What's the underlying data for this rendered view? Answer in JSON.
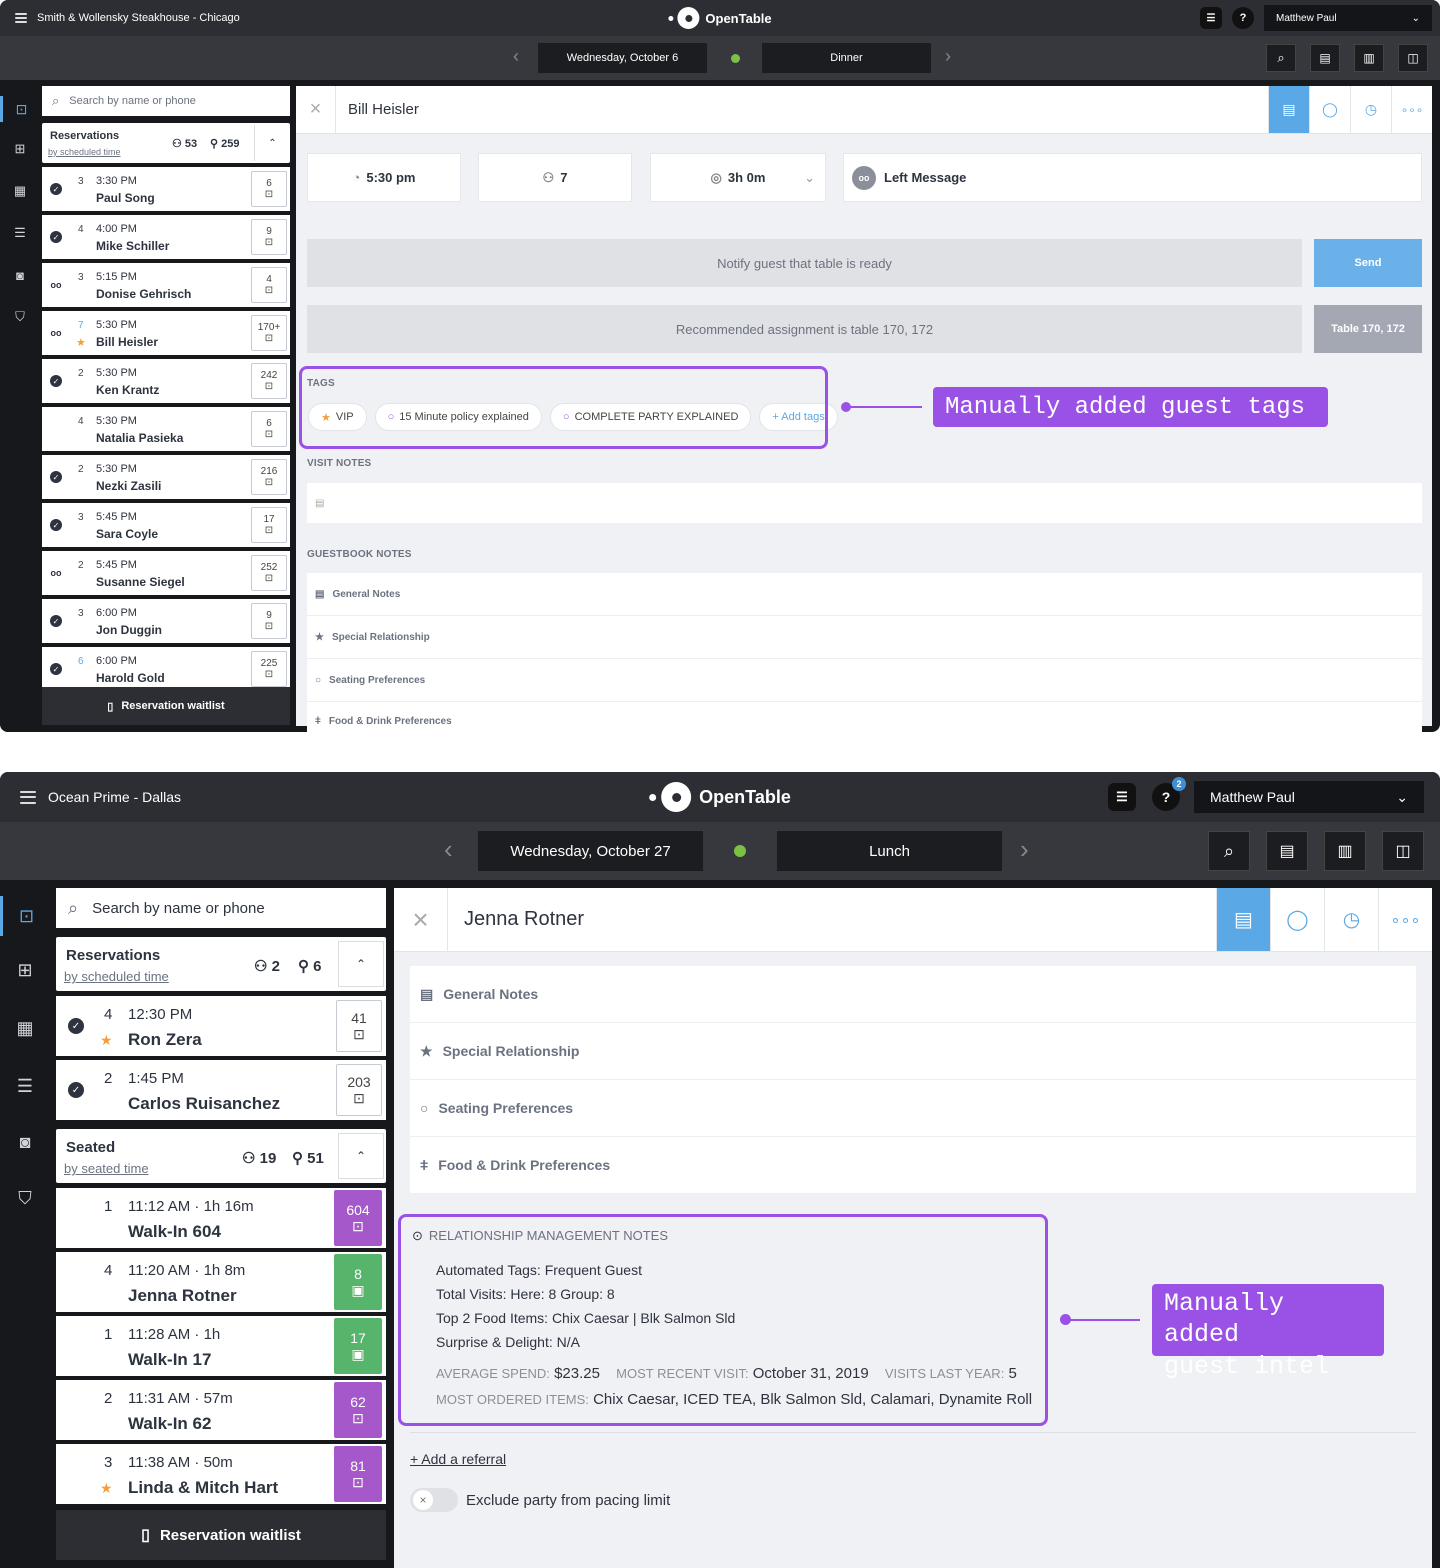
{
  "screen1": {
    "venue": "Smith & Wollensky Steakhouse - Chicago",
    "brand": "OpenTable",
    "user": "Matthew Paul",
    "date": "Wednesday, October 6",
    "shift": "Dinner",
    "search_placeholder": "Search by name or phone",
    "res_title": "Reservations",
    "res_sub": "by scheduled time",
    "res_parties": "53",
    "res_covers": "259",
    "reservations": [
      {
        "size": "3",
        "time": "3:30 PM",
        "name": "Paul Song",
        "table": "6",
        "status": "check"
      },
      {
        "size": "4",
        "time": "4:00 PM",
        "name": "Mike Schiller",
        "table": "9",
        "status": "check"
      },
      {
        "size": "3",
        "time": "5:15 PM",
        "name": "Donise Gehrisch",
        "table": "4",
        "status": "vm"
      },
      {
        "size": "7",
        "time": "5:30 PM",
        "name": "Bill Heisler",
        "table": "170+",
        "status": "vm"
      },
      {
        "size": "2",
        "time": "5:30 PM",
        "name": "Ken Krantz",
        "table": "242",
        "status": "check"
      },
      {
        "size": "4",
        "time": "5:30 PM",
        "name": "Natalia Pasieka",
        "table": "6",
        "status": "none"
      },
      {
        "size": "2",
        "time": "5:30 PM",
        "name": "Nezki Zasili",
        "table": "216",
        "status": "check"
      },
      {
        "size": "3",
        "time": "5:45 PM",
        "name": "Sara Coyle",
        "table": "17",
        "status": "check"
      },
      {
        "size": "2",
        "time": "5:45 PM",
        "name": "Susanne Siegel",
        "table": "252",
        "status": "vm"
      },
      {
        "size": "3",
        "time": "6:00 PM",
        "name": "Jon Duggin",
        "table": "9",
        "status": "check"
      },
      {
        "size": "6",
        "time": "6:00 PM",
        "name": "Harold Gold",
        "table": "225",
        "status": "check"
      }
    ],
    "waitlist": "Reservation waitlist",
    "guest": "Bill Heisler",
    "time": "5:30 pm",
    "party": "7",
    "duration": "3h 0m",
    "status": "Left Message",
    "notify": "Notify guest that table is ready",
    "send": "Send",
    "recommend": "Recommended assignment is table 170, 172",
    "table_btn": "Table 170, 172",
    "tags_label": "TAGS",
    "tags": [
      "VIP",
      "15 Minute policy explained",
      "COMPLETE PARTY EXPLAINED"
    ],
    "add_tags": "+ Add tags",
    "visit_notes": "VISIT NOTES",
    "guestbook_notes": "GUESTBOOK NOTES",
    "notes": [
      "General Notes",
      "Special Relationship",
      "Seating Preferences",
      "Food & Drink Preferences"
    ],
    "callout": "Manually added guest tags"
  },
  "screen2": {
    "venue": "Ocean Prime - Dallas",
    "brand": "OpenTable",
    "user": "Matthew Paul",
    "badge": "2",
    "date": "Wednesday, October 27",
    "shift": "Lunch",
    "search_placeholder": "Search by name or phone",
    "res_title": "Reservations",
    "res_sub": "by scheduled time",
    "res_parties": "2",
    "res_covers": "6",
    "reservations": [
      {
        "size": "4",
        "time": "12:30 PM",
        "name": "Ron Zera",
        "table": "41"
      },
      {
        "size": "2",
        "time": "1:45 PM",
        "name": "Carlos Ruisanchez",
        "table": "203"
      }
    ],
    "seated_title": "Seated",
    "seated_sub": "by seated time",
    "seated_parties": "19",
    "seated_covers": "51",
    "seated": [
      {
        "size": "1",
        "time": "11:12 AM · 1h 16m",
        "name": "Walk-In 604",
        "table": "604",
        "color": "purple"
      },
      {
        "size": "4",
        "time": "11:20 AM · 1h 8m",
        "name": "Jenna Rotner",
        "table": "8",
        "color": "green"
      },
      {
        "size": "1",
        "time": "11:28 AM · 1h",
        "name": "Walk-In 17",
        "table": "17",
        "color": "green"
      },
      {
        "size": "2",
        "time": "11:31 AM · 57m",
        "name": "Walk-In 62",
        "table": "62",
        "color": "purple"
      },
      {
        "size": "3",
        "time": "11:38 AM · 50m",
        "name": "Linda & Mitch Hart",
        "table": "81",
        "color": "purple"
      }
    ],
    "waitlist": "Reservation waitlist",
    "guest": "Jenna Rotner",
    "notes": [
      "General Notes",
      "Special Relationship",
      "Seating Preferences",
      "Food & Drink Preferences"
    ],
    "rm_title": "RELATIONSHIP MANAGEMENT NOTES",
    "rm_lines": [
      "Automated Tags: Frequent Guest",
      "Total Visits: Here: 8 Group: 8",
      "Top 2 Food Items: Chix Caesar | Blk Salmon Sld",
      "Surprise & Delight: N/A"
    ],
    "avg_label": "AVERAGE SPEND:",
    "avg_val": "$23.25",
    "recent_label": "MOST RECENT VISIT:",
    "recent_val": "October 31, 2019",
    "visits_label": "VISITS LAST YEAR:",
    "visits_val": "5",
    "ordered_label": "MOST ORDERED ITEMS:",
    "ordered_val": "Chix Caesar, ICED TEA, Blk Salmon Sld, Calamari, Dynamite Roll",
    "referral": "+ Add a referral",
    "exclude": "Exclude party from pacing limit",
    "callout1": "Manually added",
    "callout2": "guest intel"
  },
  "colors": {
    "accent": "#9a52e6",
    "blue": "#5aa9e6",
    "purple_table": "#a458c9",
    "green_table": "#57b46b"
  }
}
